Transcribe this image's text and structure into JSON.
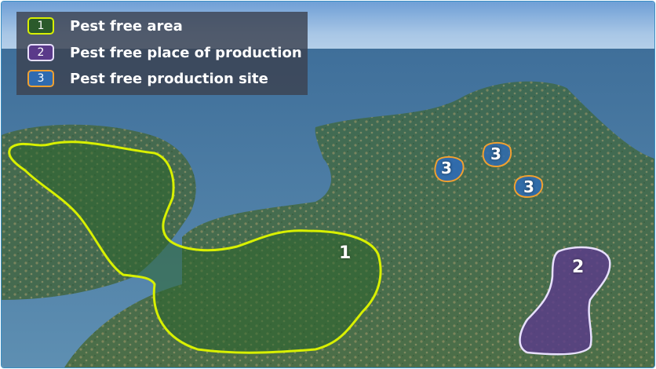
{
  "legend": {
    "items": [
      {
        "key": "1",
        "label": "Pest free area",
        "fill": "#2b5a2b",
        "border": "#d8f000"
      },
      {
        "key": "2",
        "label": "Pest free place of production",
        "fill": "#5a3a8a",
        "border": "#e8e0ff"
      },
      {
        "key": "3",
        "label": "Pest free production site",
        "fill": "#2f6bb0",
        "border": "#f0a030"
      }
    ]
  },
  "map": {
    "zones": [
      {
        "id": "1",
        "label": "1"
      },
      {
        "id": "2",
        "label": "2"
      },
      {
        "id": "3a",
        "label": "3"
      },
      {
        "id": "3b",
        "label": "3"
      },
      {
        "id": "3c",
        "label": "3"
      }
    ]
  }
}
